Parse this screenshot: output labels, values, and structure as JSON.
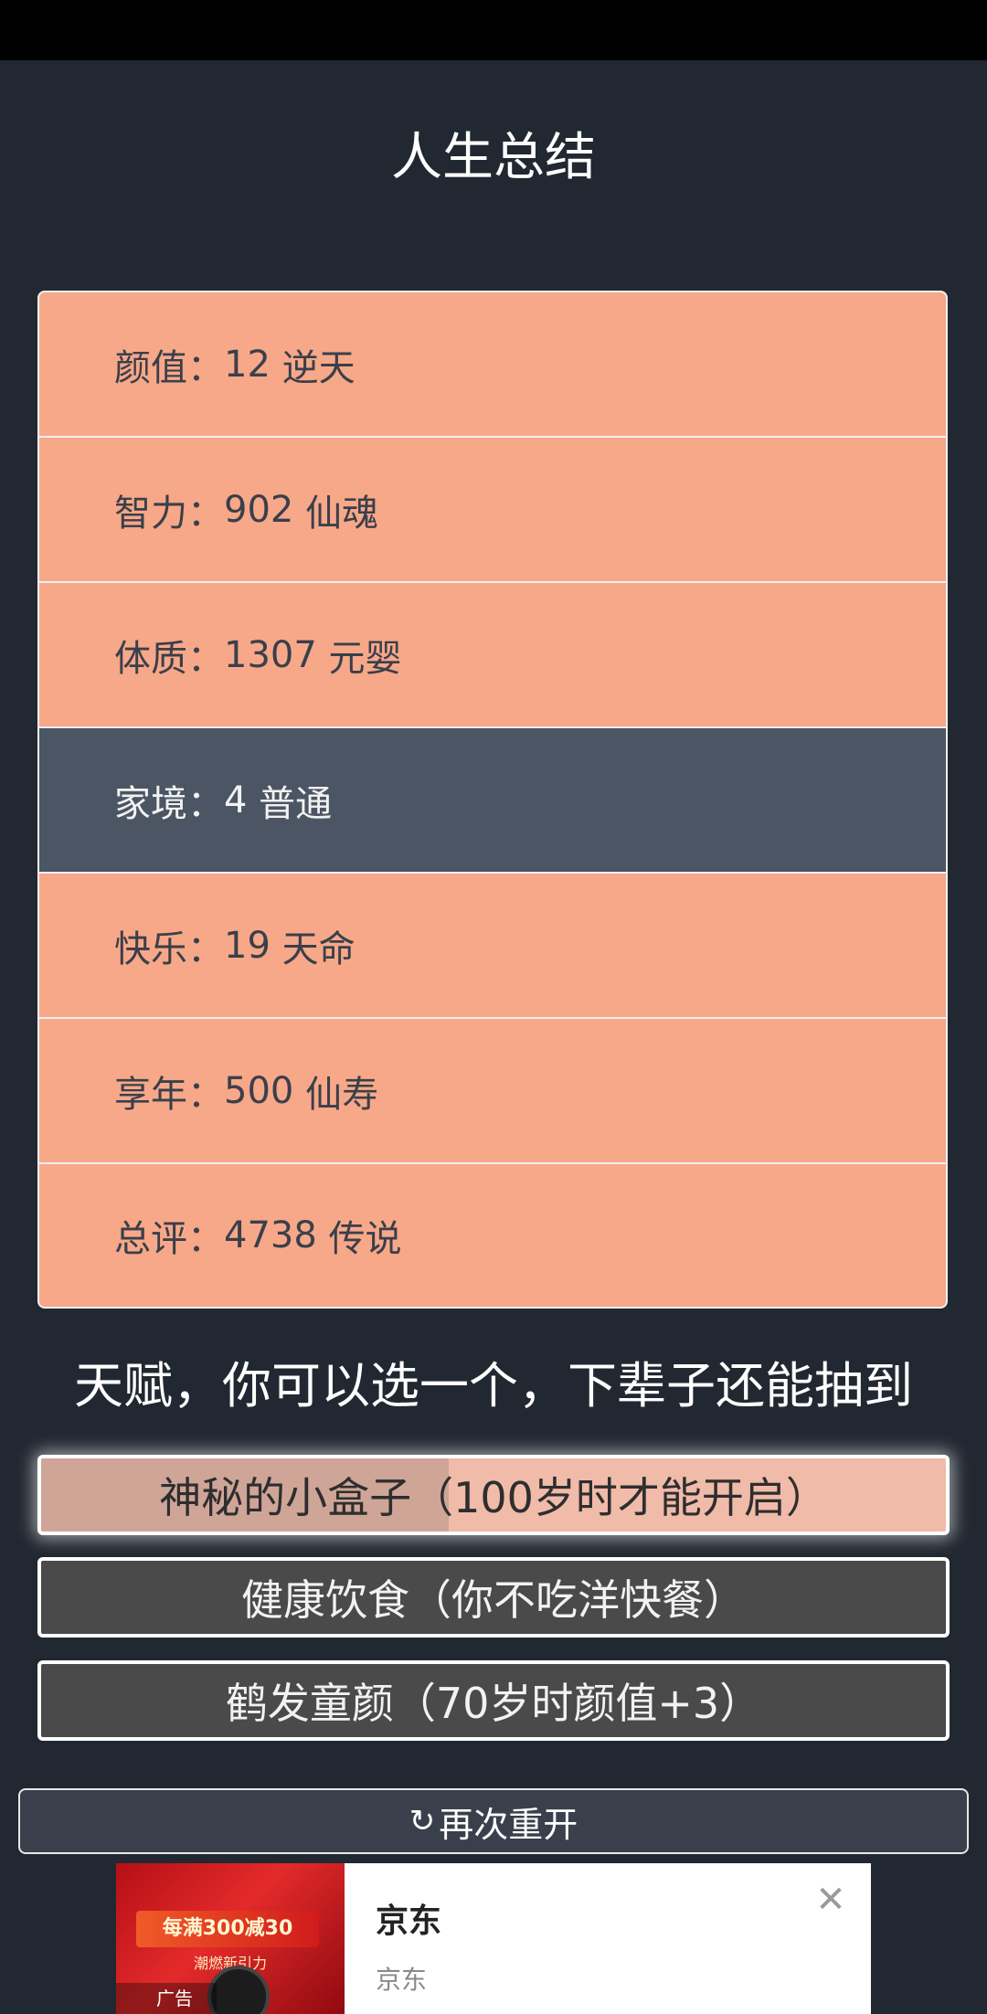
{
  "page_title": "人生总结",
  "summary": [
    {
      "label": "颜值",
      "value": "12",
      "rank": "逆天",
      "highlight": false
    },
    {
      "label": "智力",
      "value": "902",
      "rank": "仙魂",
      "highlight": false
    },
    {
      "label": "体质",
      "value": "1307",
      "rank": "元婴",
      "highlight": false
    },
    {
      "label": "家境",
      "value": "4",
      "rank": "普通",
      "highlight": true
    },
    {
      "label": "快乐",
      "value": "19",
      "rank": "天命",
      "highlight": false
    },
    {
      "label": "享年",
      "value": "500",
      "rank": "仙寿",
      "highlight": false
    },
    {
      "label": "总评",
      "value": "4738",
      "rank": "传说",
      "highlight": false
    }
  ],
  "separator": "：",
  "talent_header": "天赋，你可以选一个，下辈子还能抽到",
  "talents": [
    {
      "label": "神秘的小盒子（100岁时才能开启）",
      "selected": true,
      "progress": 0.45
    },
    {
      "label": "健康饮食（你不吃洋快餐）",
      "selected": false
    },
    {
      "label": "鹤发童颜（70岁时颜值+3）",
      "selected": false
    }
  ],
  "restart": {
    "icon": "refresh-icon",
    "glyph": "↻",
    "label": "再次重开"
  },
  "ad": {
    "image_promo": "每满300减30",
    "image_sub": "潮燃新引力",
    "tag": "广告",
    "title": "京东",
    "subtitle": "京东",
    "close_glyph": "✕"
  },
  "colors": {
    "background": "#222831",
    "row": "#f7a888",
    "row_highlight": "#4b5563",
    "talent": "#4a4a4a",
    "talent_selected": "#f0bba8"
  }
}
